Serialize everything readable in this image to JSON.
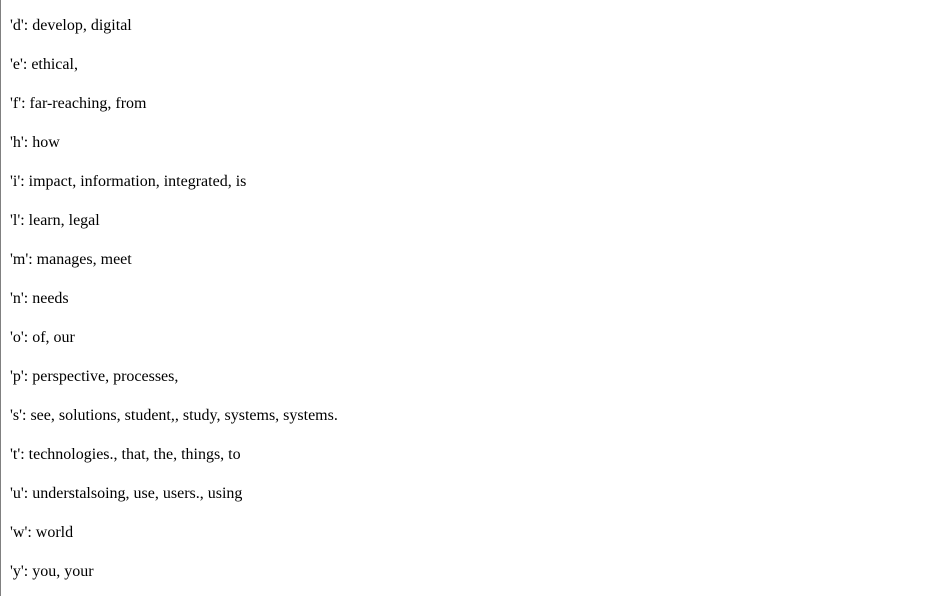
{
  "lines": [
    "'d': develop, digital",
    "'e': ethical,",
    "'f': far-reaching, from",
    "'h': how",
    "'i': impact, information, integrated, is",
    "'l': learn, legal",
    "'m': manages, meet",
    "'n': needs",
    "'o': of, our",
    "'p': perspective, processes,",
    "'s': see, solutions, student,, study, systems, systems.",
    "'t': technologies., that, the, things, to",
    "'u': understalsoing, use, users., using",
    "'w': world",
    "'y': you, your"
  ]
}
